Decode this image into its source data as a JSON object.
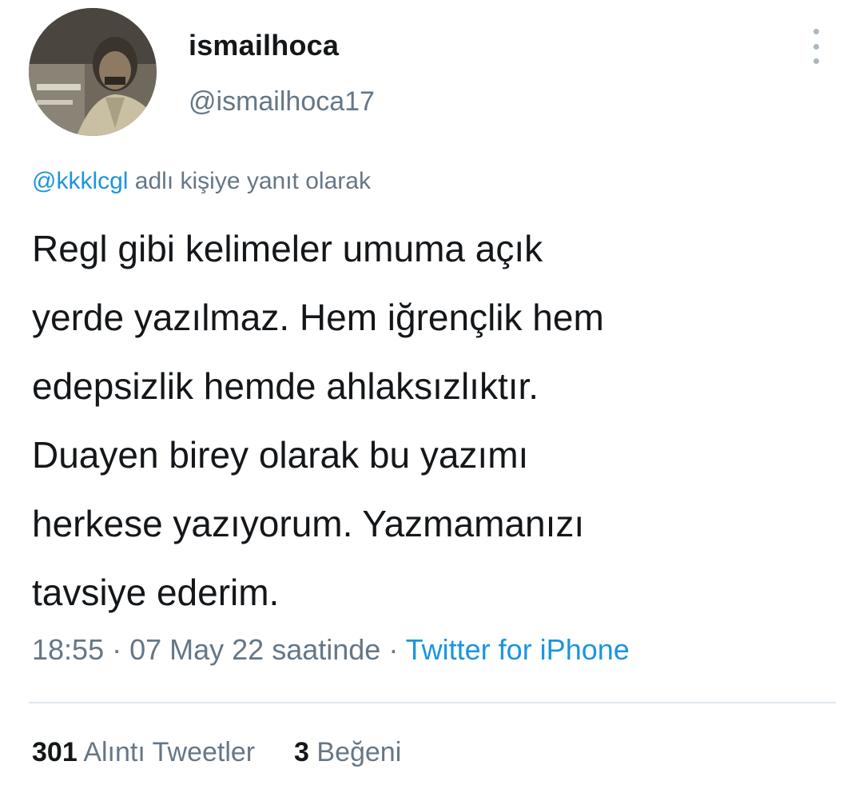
{
  "author": {
    "display_name": "ismailhoca",
    "handle": "@ismailhoca17"
  },
  "reply": {
    "mention": "@kkklcgl",
    "suffix": " adlı kişiye yanıt olarak"
  },
  "tweet": {
    "lines": [
      "Regl gibi kelimeler umuma açık",
      "yerde yazılmaz. Hem iğrençlik hem",
      "edepsizlik hemde ahlaksızlıktır.",
      "Duayen birey olarak bu yazımı",
      "herkese yazıyorum. Yazmamanızı",
      "tavsiye ederim."
    ]
  },
  "meta": {
    "time": "18:55",
    "separator": " · ",
    "date": "07 May 22 saatinde",
    "source": "Twitter for iPhone"
  },
  "stats": {
    "quote_count": "301",
    "quote_label": "Alıntı Tweetler",
    "like_count": "3",
    "like_label": "Beğeni"
  },
  "icons": {
    "more": "more-vertical-icon",
    "avatar": "profile-photo"
  },
  "colors": {
    "link": "#1b95e0",
    "muted": "#657786",
    "text": "#14171a",
    "divider": "#e1e8ed"
  }
}
